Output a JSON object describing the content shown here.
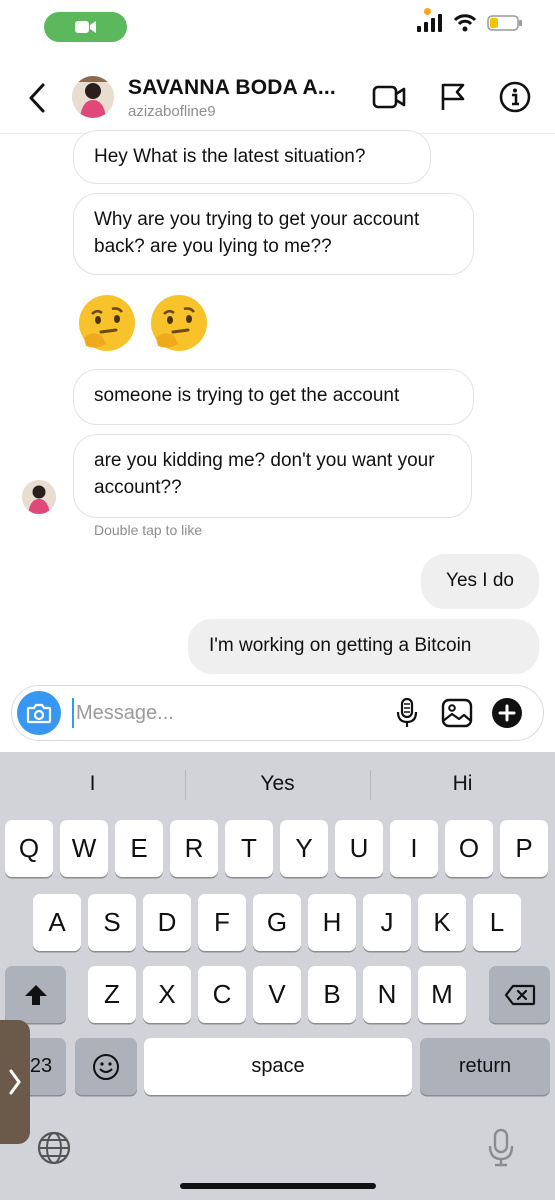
{
  "header": {
    "contact_name": "SAVANNA BODA A...",
    "username": "azizabofline9"
  },
  "messages": [
    {
      "text": "Hey What is the latest situation?",
      "direction": "received"
    },
    {
      "text": "Why are you trying to get your account back?  are you lying to me??",
      "direction": "received"
    },
    {
      "text": "🤔🤔",
      "direction": "received",
      "kind": "emoji"
    },
    {
      "text": "someone is trying to get the account",
      "direction": "received"
    },
    {
      "text": "are you kidding me?  don't you want your account??",
      "direction": "received"
    },
    {
      "text": "Yes I do",
      "direction": "sent"
    },
    {
      "text": "I'm working on getting a Bitcoin",
      "direction": "sent"
    }
  ],
  "hint": "Double tap to like",
  "composer": {
    "placeholder": "Message..."
  },
  "keyboard": {
    "suggestions": [
      "I",
      "Yes",
      "Hi"
    ],
    "row1": [
      "Q",
      "W",
      "E",
      "R",
      "T",
      "Y",
      "U",
      "I",
      "O",
      "P"
    ],
    "row2": [
      "A",
      "S",
      "D",
      "F",
      "G",
      "H",
      "J",
      "K",
      "L"
    ],
    "row3": [
      "Z",
      "X",
      "C",
      "V",
      "B",
      "N",
      "M"
    ],
    "numbers_key": "123",
    "space_key": "space",
    "return_key": "return"
  },
  "colors": {
    "accent": "#3897f0",
    "call_pill": "#5cb85c",
    "keyboard_bg": "#d1d3d9"
  }
}
